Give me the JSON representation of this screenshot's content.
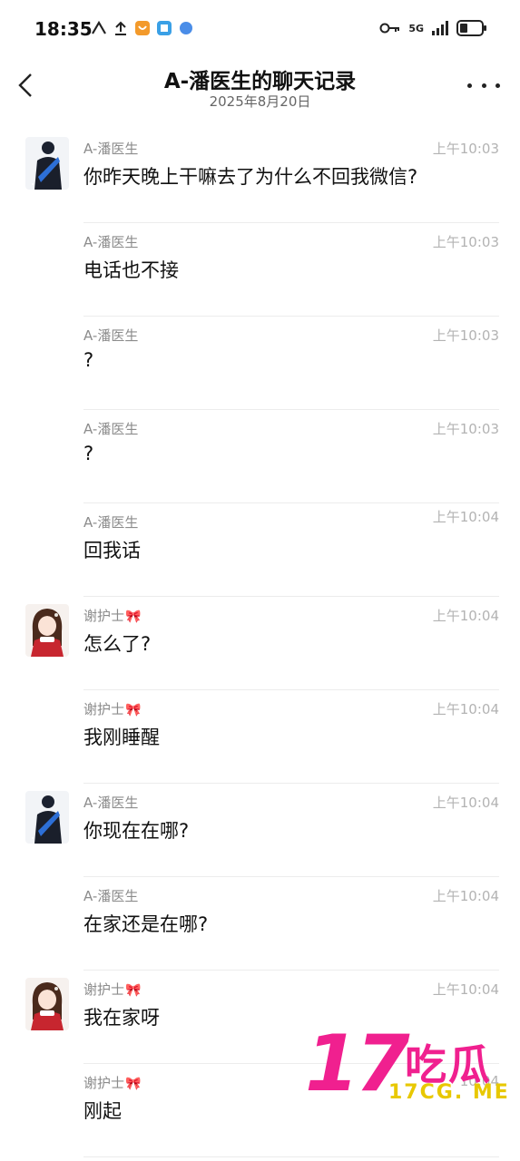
{
  "status_bar": {
    "time": "18:35",
    "network": "5G"
  },
  "header": {
    "title": "A-潘医生的聊天记录",
    "date": "2025年8月20日"
  },
  "messages": [
    {
      "sender": "A-潘医生",
      "time": "上午10:03",
      "text": "你昨天晚上干嘛去了为什么不回我微信?",
      "avatar": "doctor"
    },
    {
      "sender": "A-潘医生",
      "time": "上午10:03",
      "text": "电话也不接",
      "avatar": ""
    },
    {
      "sender": "A-潘医生",
      "time": "上午10:03",
      "text": "?",
      "avatar": ""
    },
    {
      "sender": "A-潘医生",
      "time": "上午10:03",
      "text": "?",
      "avatar": ""
    },
    {
      "sender": "A-潘医生",
      "time": "上午10:04",
      "text": "回我话",
      "avatar": ""
    },
    {
      "sender": "谢护士",
      "time": "上午10:04",
      "text": "怎么了?",
      "avatar": "nurse"
    },
    {
      "sender": "谢护士",
      "time": "上午10:04",
      "text": "我刚睡醒",
      "avatar": ""
    },
    {
      "sender": "A-潘医生",
      "time": "上午10:04",
      "text": "你现在在哪?",
      "avatar": "doctor"
    },
    {
      "sender": "A-潘医生",
      "time": "上午10:04",
      "text": "在家还是在哪?",
      "avatar": ""
    },
    {
      "sender": "谢护士",
      "time": "上午10:04",
      "text": "我在家呀",
      "avatar": "nurse"
    },
    {
      "sender": "谢护士",
      "time": "10:04",
      "text": "刚起",
      "avatar": ""
    }
  ],
  "watermark": {
    "number": "17",
    "chinese": "吃瓜",
    "url": "17CG. ME"
  },
  "colors": {
    "accent_pink": "#f0208f",
    "accent_yellow": "#e8c800",
    "muted_text": "#8c8c8c"
  }
}
